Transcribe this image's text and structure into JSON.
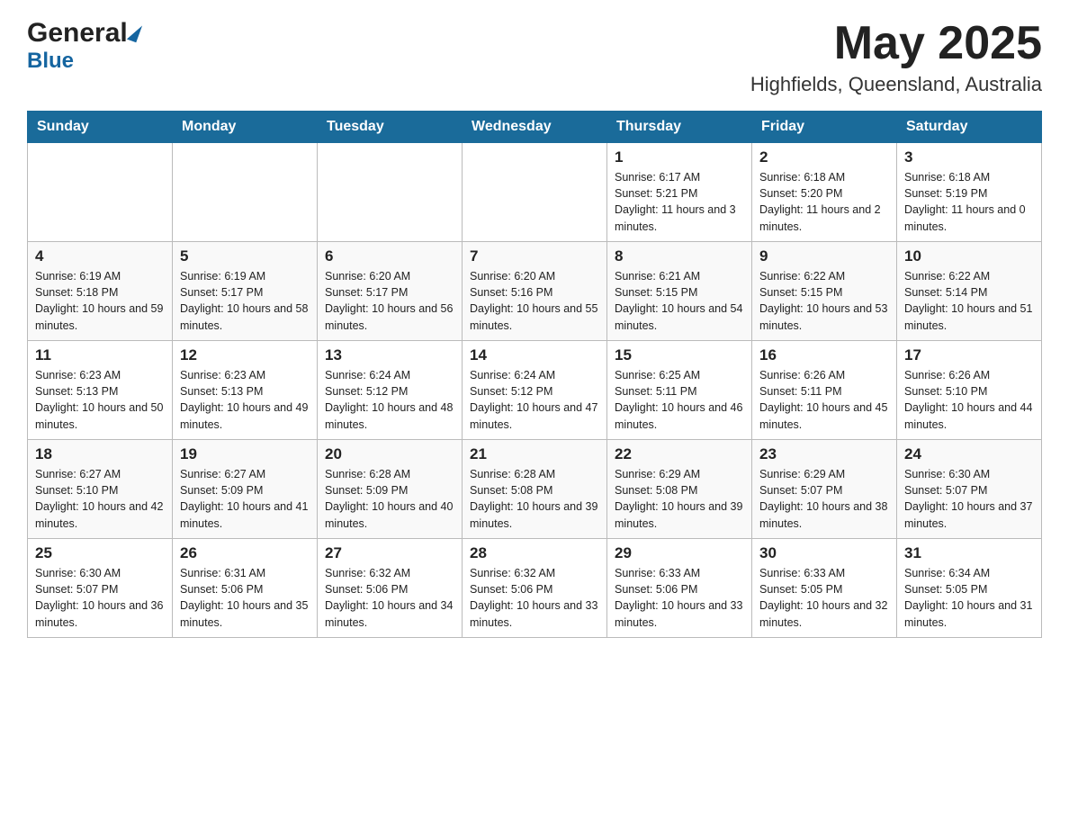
{
  "header": {
    "logo_general": "General",
    "logo_blue": "Blue",
    "month_title": "May 2025",
    "location": "Highfields, Queensland, Australia"
  },
  "calendar": {
    "days_of_week": [
      "Sunday",
      "Monday",
      "Tuesday",
      "Wednesday",
      "Thursday",
      "Friday",
      "Saturday"
    ],
    "weeks": [
      [
        {
          "day": "",
          "info": ""
        },
        {
          "day": "",
          "info": ""
        },
        {
          "day": "",
          "info": ""
        },
        {
          "day": "",
          "info": ""
        },
        {
          "day": "1",
          "info": "Sunrise: 6:17 AM\nSunset: 5:21 PM\nDaylight: 11 hours and 3 minutes."
        },
        {
          "day": "2",
          "info": "Sunrise: 6:18 AM\nSunset: 5:20 PM\nDaylight: 11 hours and 2 minutes."
        },
        {
          "day": "3",
          "info": "Sunrise: 6:18 AM\nSunset: 5:19 PM\nDaylight: 11 hours and 0 minutes."
        }
      ],
      [
        {
          "day": "4",
          "info": "Sunrise: 6:19 AM\nSunset: 5:18 PM\nDaylight: 10 hours and 59 minutes."
        },
        {
          "day": "5",
          "info": "Sunrise: 6:19 AM\nSunset: 5:17 PM\nDaylight: 10 hours and 58 minutes."
        },
        {
          "day": "6",
          "info": "Sunrise: 6:20 AM\nSunset: 5:17 PM\nDaylight: 10 hours and 56 minutes."
        },
        {
          "day": "7",
          "info": "Sunrise: 6:20 AM\nSunset: 5:16 PM\nDaylight: 10 hours and 55 minutes."
        },
        {
          "day": "8",
          "info": "Sunrise: 6:21 AM\nSunset: 5:15 PM\nDaylight: 10 hours and 54 minutes."
        },
        {
          "day": "9",
          "info": "Sunrise: 6:22 AM\nSunset: 5:15 PM\nDaylight: 10 hours and 53 minutes."
        },
        {
          "day": "10",
          "info": "Sunrise: 6:22 AM\nSunset: 5:14 PM\nDaylight: 10 hours and 51 minutes."
        }
      ],
      [
        {
          "day": "11",
          "info": "Sunrise: 6:23 AM\nSunset: 5:13 PM\nDaylight: 10 hours and 50 minutes."
        },
        {
          "day": "12",
          "info": "Sunrise: 6:23 AM\nSunset: 5:13 PM\nDaylight: 10 hours and 49 minutes."
        },
        {
          "day": "13",
          "info": "Sunrise: 6:24 AM\nSunset: 5:12 PM\nDaylight: 10 hours and 48 minutes."
        },
        {
          "day": "14",
          "info": "Sunrise: 6:24 AM\nSunset: 5:12 PM\nDaylight: 10 hours and 47 minutes."
        },
        {
          "day": "15",
          "info": "Sunrise: 6:25 AM\nSunset: 5:11 PM\nDaylight: 10 hours and 46 minutes."
        },
        {
          "day": "16",
          "info": "Sunrise: 6:26 AM\nSunset: 5:11 PM\nDaylight: 10 hours and 45 minutes."
        },
        {
          "day": "17",
          "info": "Sunrise: 6:26 AM\nSunset: 5:10 PM\nDaylight: 10 hours and 44 minutes."
        }
      ],
      [
        {
          "day": "18",
          "info": "Sunrise: 6:27 AM\nSunset: 5:10 PM\nDaylight: 10 hours and 42 minutes."
        },
        {
          "day": "19",
          "info": "Sunrise: 6:27 AM\nSunset: 5:09 PM\nDaylight: 10 hours and 41 minutes."
        },
        {
          "day": "20",
          "info": "Sunrise: 6:28 AM\nSunset: 5:09 PM\nDaylight: 10 hours and 40 minutes."
        },
        {
          "day": "21",
          "info": "Sunrise: 6:28 AM\nSunset: 5:08 PM\nDaylight: 10 hours and 39 minutes."
        },
        {
          "day": "22",
          "info": "Sunrise: 6:29 AM\nSunset: 5:08 PM\nDaylight: 10 hours and 39 minutes."
        },
        {
          "day": "23",
          "info": "Sunrise: 6:29 AM\nSunset: 5:07 PM\nDaylight: 10 hours and 38 minutes."
        },
        {
          "day": "24",
          "info": "Sunrise: 6:30 AM\nSunset: 5:07 PM\nDaylight: 10 hours and 37 minutes."
        }
      ],
      [
        {
          "day": "25",
          "info": "Sunrise: 6:30 AM\nSunset: 5:07 PM\nDaylight: 10 hours and 36 minutes."
        },
        {
          "day": "26",
          "info": "Sunrise: 6:31 AM\nSunset: 5:06 PM\nDaylight: 10 hours and 35 minutes."
        },
        {
          "day": "27",
          "info": "Sunrise: 6:32 AM\nSunset: 5:06 PM\nDaylight: 10 hours and 34 minutes."
        },
        {
          "day": "28",
          "info": "Sunrise: 6:32 AM\nSunset: 5:06 PM\nDaylight: 10 hours and 33 minutes."
        },
        {
          "day": "29",
          "info": "Sunrise: 6:33 AM\nSunset: 5:06 PM\nDaylight: 10 hours and 33 minutes."
        },
        {
          "day": "30",
          "info": "Sunrise: 6:33 AM\nSunset: 5:05 PM\nDaylight: 10 hours and 32 minutes."
        },
        {
          "day": "31",
          "info": "Sunrise: 6:34 AM\nSunset: 5:05 PM\nDaylight: 10 hours and 31 minutes."
        }
      ]
    ]
  }
}
